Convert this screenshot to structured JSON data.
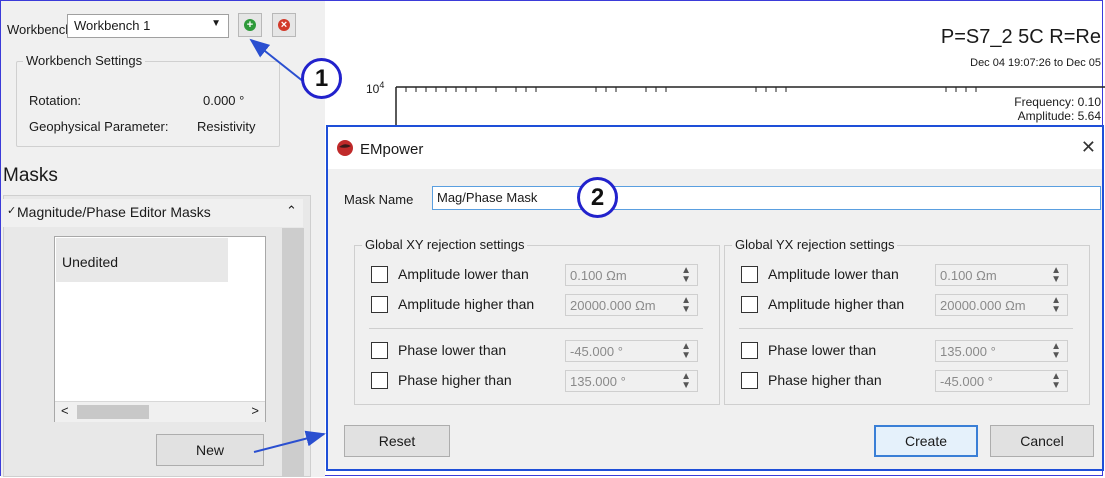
{
  "workbench": {
    "label": "Workbench",
    "selected": "Workbench 1",
    "add_icon": "plus-circle-icon",
    "remove_icon": "x-circle-icon"
  },
  "settings": {
    "title": "Workbench Settings",
    "rotation_label": "Rotation:",
    "rotation_value": "0.000 °",
    "geo_label": "Geophysical Parameter:",
    "geo_value": "Resistivity"
  },
  "masks": {
    "title": "Masks",
    "section_label": "Magnitude/Phase Editor Masks",
    "items": [
      "Unedited"
    ],
    "new_button": "New"
  },
  "plot": {
    "title": "P=S7_2 5C R=Re",
    "subtitle": "Dec 04 19:07:26 to Dec 05",
    "y_tick": "10",
    "y_tick_exp": "4",
    "frequency_label": "Frequency: 0.10",
    "amplitude_label": "Amplitude: 5.64"
  },
  "callouts": [
    "1",
    "2"
  ],
  "dialog": {
    "title": "EMpower",
    "mask_name_label": "Mask Name",
    "mask_name_value": "Mag/Phase Mask",
    "xy": {
      "title": "Global XY rejection settings",
      "rows": [
        {
          "label": "Amplitude lower than",
          "value": "0.100 Ωm"
        },
        {
          "label": "Amplitude higher than",
          "value": "20000.000 Ωm"
        },
        {
          "label": "Phase lower than",
          "value": "-45.000 °"
        },
        {
          "label": "Phase higher than",
          "value": "135.000 °"
        }
      ]
    },
    "yx": {
      "title": "Global YX rejection settings",
      "rows": [
        {
          "label": "Amplitude lower than",
          "value": "0.100 Ωm"
        },
        {
          "label": "Amplitude higher than",
          "value": "20000.000 Ωm"
        },
        {
          "label": "Phase lower than",
          "value": "135.000 °"
        },
        {
          "label": "Phase higher than",
          "value": "-45.000 °"
        }
      ]
    },
    "reset_button": "Reset",
    "create_button": "Create",
    "cancel_button": "Cancel"
  },
  "colors": {
    "accent": "#1e4fd8",
    "add_green": "#2e9a3a",
    "remove_red": "#d23a2a"
  }
}
